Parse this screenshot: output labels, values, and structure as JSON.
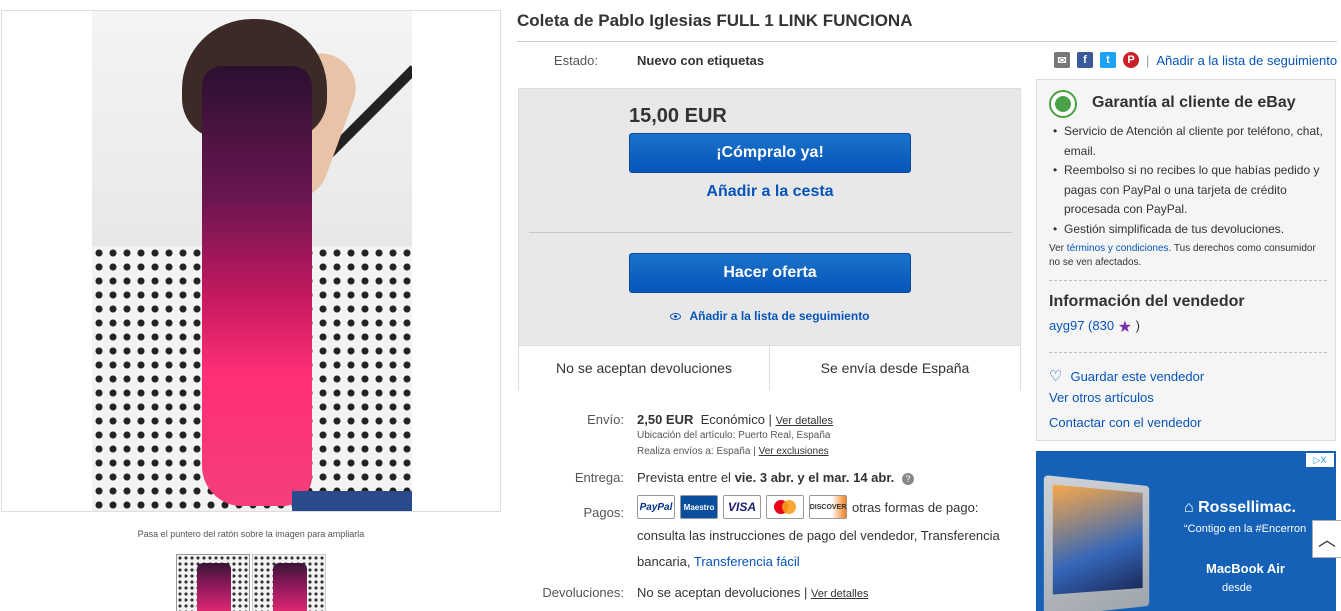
{
  "product": {
    "title": "Coleta de Pablo Iglesias FULL 1 LINK FUNCIONA",
    "condition_label": "Estado:",
    "condition_value": "Nuevo con etiquetas"
  },
  "gallery": {
    "hint": "Pasa el puntero del ratón sobre la imagen para ampliarla"
  },
  "social": {
    "icons": [
      "mail-icon",
      "facebook-icon",
      "twitter-icon",
      "pinterest-icon"
    ],
    "watch_link": "Añadir a la lista de seguimiento"
  },
  "buybox": {
    "price": "15,00 EUR",
    "buy_now": "¡Cómpralo ya!",
    "add_to_cart": "Añadir a la cesta",
    "make_offer": "Hacer oferta",
    "watch": "Añadir a la lista de seguimiento",
    "returns": "No se aceptan devoluciones",
    "ships_from": "Se envía desde España",
    "accent": "#0654ba"
  },
  "shipping": {
    "label": "Envío:",
    "cost": "2,50 EUR",
    "service": "Económico",
    "sep": "|",
    "details_link": "Ver detalles",
    "location_label": "Ubicación del artículo:",
    "location": "Puerto Real, España",
    "ships_to_label": "Realiza envíos a:",
    "ships_to": "España",
    "exclusions_sep": "|",
    "exclusions": "Ver exclusiones"
  },
  "delivery": {
    "label": "Entrega:",
    "prefix": "Prevista entre el",
    "range": "vie. 3 abr. y el mar. 14 abr."
  },
  "payments": {
    "label": "Pagos:",
    "logos": [
      "PayPal",
      "Maestro",
      "VISA",
      "MasterCard",
      "DISCOVER"
    ],
    "other": "otras formas de pago:",
    "line2": "consulta las instrucciones de pago del vendedor, Transferencia",
    "line3": "bancaria,",
    "line3_link": "Transferencia fácil"
  },
  "returns": {
    "label": "Devoluciones:",
    "value": "No se aceptan devoluciones",
    "sep": "|",
    "details_link": "Ver detalles"
  },
  "guarantee": {
    "title": "Garantía al cliente de eBay",
    "items": [
      "Servicio de Atención al cliente por teléfono, chat, email.",
      "Reembolso si no recibes lo que habías pedido y pagas con PayPal o una tarjeta de crédito procesada con PayPal.",
      "Gestión simplificada de tus devoluciones."
    ],
    "note_prefix": "Ver",
    "note_link": "términos y condiciones",
    "note_suffix": ". Tus derechos como consumidor no se ven afectados."
  },
  "seller": {
    "heading": "Información del vendedor",
    "name": "ayg97",
    "feedback": "(830",
    "close_paren": ")",
    "save": "Guardar este vendedor",
    "other_items": "Ver otros artículos",
    "contact": "Contactar con el vendedor"
  },
  "ad": {
    "brand": "Rossellimac.",
    "slogan": "“Contigo en la #Encerron",
    "product": "MacBook Air",
    "desde": "desde",
    "adchoices": "▷X"
  }
}
